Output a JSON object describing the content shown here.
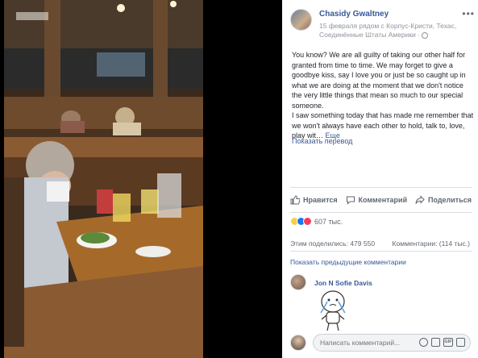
{
  "post": {
    "author": "Chasidy Gwaltney",
    "meta": "15 февраля рядом с Корпус-Кристи, Техас, Соединённые Штаты Америки ·",
    "paragraph1": "You know? We are all guilty of taking our other half for granted from time to time. We may forget to give a goodbye kiss, say I love you or just be so caught up in what we are doing at the moment that we don't notice the very little things that mean so much to our special someone.",
    "paragraph2": "I saw something today that has made me remember that we won't always have each other to hold, talk to, love, play wit…",
    "more_link": "Еще",
    "translate": "Показать перевод"
  },
  "actions": {
    "like": "Нравится",
    "comment": "Комментарий",
    "share": "Поделиться"
  },
  "stats": {
    "reactions_count": "607 тыс.",
    "shares": "Этим поделились: 479 550",
    "comments": "Комментарии: (114 тыс.)"
  },
  "comments": {
    "prev_link": "Показать предыдущие комментарии",
    "items": [
      {
        "name": "Jon N Sofie Davis"
      }
    ]
  },
  "compose": {
    "placeholder": "Написать комментарий..."
  },
  "colors": {
    "link": "#385898",
    "meta": "#90949c",
    "background": "#000000",
    "panel": "#ffffff"
  },
  "icons": {
    "more": "more-dots-icon",
    "globe": "globe-icon",
    "like": "thumbs-up-icon",
    "comment": "speech-bubble-icon",
    "share": "share-arrow-icon",
    "emoji": "smiley-icon",
    "camera": "camera-icon",
    "gif": "gif-icon",
    "sticker": "sticker-icon"
  }
}
